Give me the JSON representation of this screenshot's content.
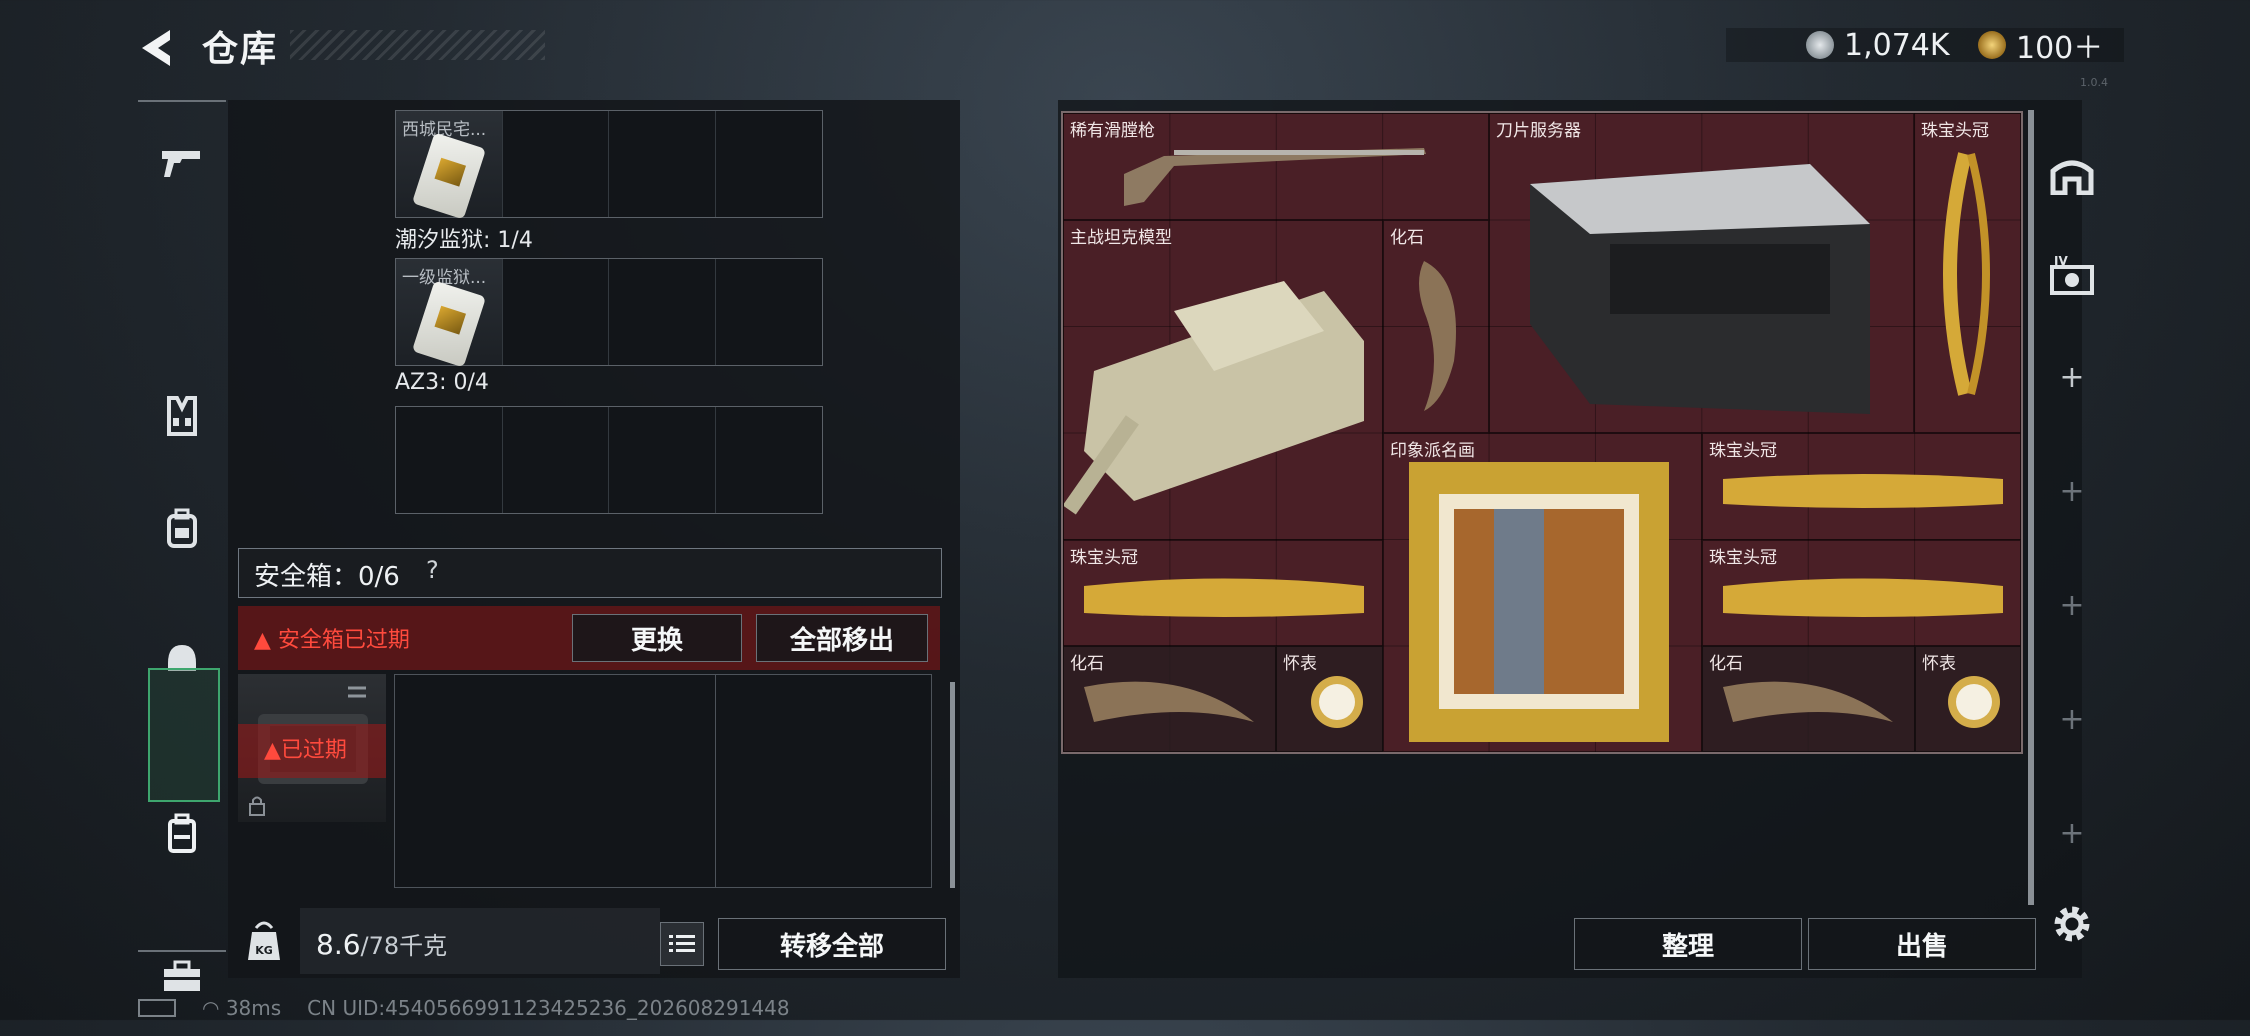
{
  "header": {
    "title": "仓库",
    "currency_silver": "1,074K",
    "currency_gold": "100＋",
    "silver_color": "#b8c0c6",
    "gold_color": "#c9a14a",
    "watermark": "1.0.4"
  },
  "left_rail": {
    "items": [
      {
        "name": "gun-icon",
        "active": false
      },
      {
        "name": "vest-icon",
        "active": false
      },
      {
        "name": "backpack-icon",
        "active": false
      },
      {
        "name": "helmet-icon",
        "active": false
      },
      {
        "name": "safe-case-icon",
        "active": true
      },
      {
        "name": "toolbox-icon",
        "active": false
      }
    ]
  },
  "key_slots": {
    "slot1_item_label": "西城民宅...",
    "section2_label": "潮汐监狱: 1/4",
    "slot2_item_label": "一级监狱...",
    "section3_label": "AZ3: 0/4"
  },
  "safe_box": {
    "label": "安全箱：0/6",
    "help": "?",
    "alert": "安全箱已过期",
    "swap_button": "更换",
    "move_all_button": "全部移出",
    "expired_label": "已过期"
  },
  "bottom_left": {
    "weight_value": "8.6",
    "weight_unit": "/78千克",
    "kg_badge": "KG",
    "transfer_all_button": "转移全部"
  },
  "status_bar": {
    "ping": "38ms",
    "uid": "CN UID:4540566991123425236_202608291448"
  },
  "inventory": {
    "items": [
      {
        "label": "稀有滑膛枪",
        "icon": "musket-icon"
      },
      {
        "label": "刀片服务器",
        "icon": "server-icon"
      },
      {
        "label": "珠宝头冠",
        "icon": "tiara-icon"
      },
      {
        "label": "主战坦克模型",
        "icon": "tank-icon"
      },
      {
        "label": "化石",
        "icon": "fossil-icon"
      },
      {
        "label": "印象派名画",
        "icon": "painting-icon"
      },
      {
        "label": "珠宝头冠",
        "icon": "tiara-icon"
      },
      {
        "label": "珠宝头冠",
        "icon": "tiara-icon"
      },
      {
        "label": "珠宝头冠",
        "icon": "tiara-icon"
      },
      {
        "label": "化石",
        "icon": "fossil-icon"
      },
      {
        "label": "怀表",
        "icon": "pocket-watch-icon"
      },
      {
        "label": "化石",
        "icon": "fossil-icon"
      },
      {
        "label": "怀表",
        "icon": "pocket-watch-icon"
      }
    ],
    "cell_color": "#4a1f26",
    "sort_button": "整理",
    "sell_button": "出售"
  },
  "right_rail": {
    "items": [
      "stash-icon",
      "camera-loadout-icon",
      "plus-icon",
      "plus-icon",
      "plus-icon",
      "plus-icon",
      "plus-icon"
    ],
    "plus": "+"
  }
}
